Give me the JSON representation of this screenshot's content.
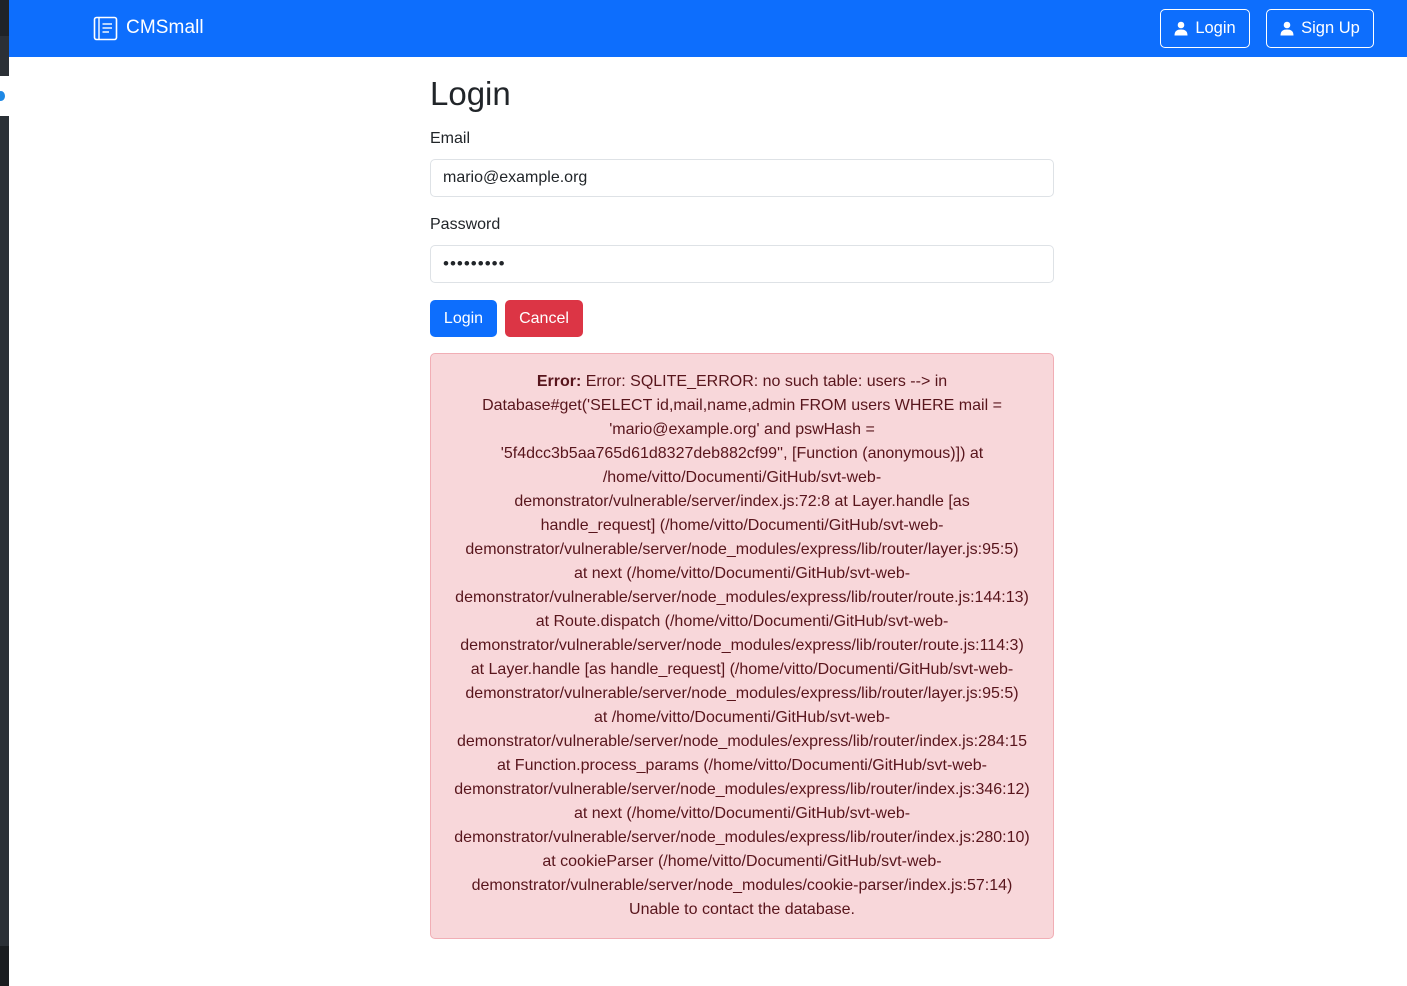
{
  "navbar": {
    "brand": "CMSmall",
    "login_label": "Login",
    "signup_label": "Sign Up",
    "color": "#0d6efd"
  },
  "form": {
    "title": "Login",
    "email_label": "Email",
    "email_value": "mario@example.org",
    "password_label": "Password",
    "password_value": "•••••••••",
    "login_button": "Login",
    "cancel_button": "Cancel"
  },
  "error": {
    "prefix": "Error:",
    "lines": [
      "Error: SQLITE_ERROR: no such table: users --> in",
      "Database#get('SELECT id,mail,name,admin FROM users WHERE mail =",
      "'mario@example.org' and pswHash =",
      "'5f4dcc3b5aa765d61d8327deb882cf99'', [Function (anonymous)]) at",
      "/home/vitto/Documenti/GitHub/svt-web-",
      "demonstrator/vulnerable/server/index.js:72:8 at Layer.handle [as",
      "handle_request] (/home/vitto/Documenti/GitHub/svt-web-",
      "demonstrator/vulnerable/server/node_modules/express/lib/router/layer.js:95:5)",
      "at next (/home/vitto/Documenti/GitHub/svt-web-",
      "demonstrator/vulnerable/server/node_modules/express/lib/router/route.js:144:13)",
      "at Route.dispatch (/home/vitto/Documenti/GitHub/svt-web-",
      "demonstrator/vulnerable/server/node_modules/express/lib/router/route.js:114:3)",
      "at Layer.handle [as handle_request] (/home/vitto/Documenti/GitHub/svt-web-",
      "demonstrator/vulnerable/server/node_modules/express/lib/router/layer.js:95:5)",
      "at /home/vitto/Documenti/GitHub/svt-web-",
      "demonstrator/vulnerable/server/node_modules/express/lib/router/index.js:284:15",
      "at Function.process_params (/home/vitto/Documenti/GitHub/svt-web-",
      "demonstrator/vulnerable/server/node_modules/express/lib/router/index.js:346:12)",
      "at next (/home/vitto/Documenti/GitHub/svt-web-",
      "demonstrator/vulnerable/server/node_modules/express/lib/router/index.js:280:10)",
      "at cookieParser (/home/vitto/Documenti/GitHub/svt-web-",
      "demonstrator/vulnerable/server/node_modules/cookie-parser/index.js:57:14)",
      "Unable to contact the database."
    ]
  }
}
